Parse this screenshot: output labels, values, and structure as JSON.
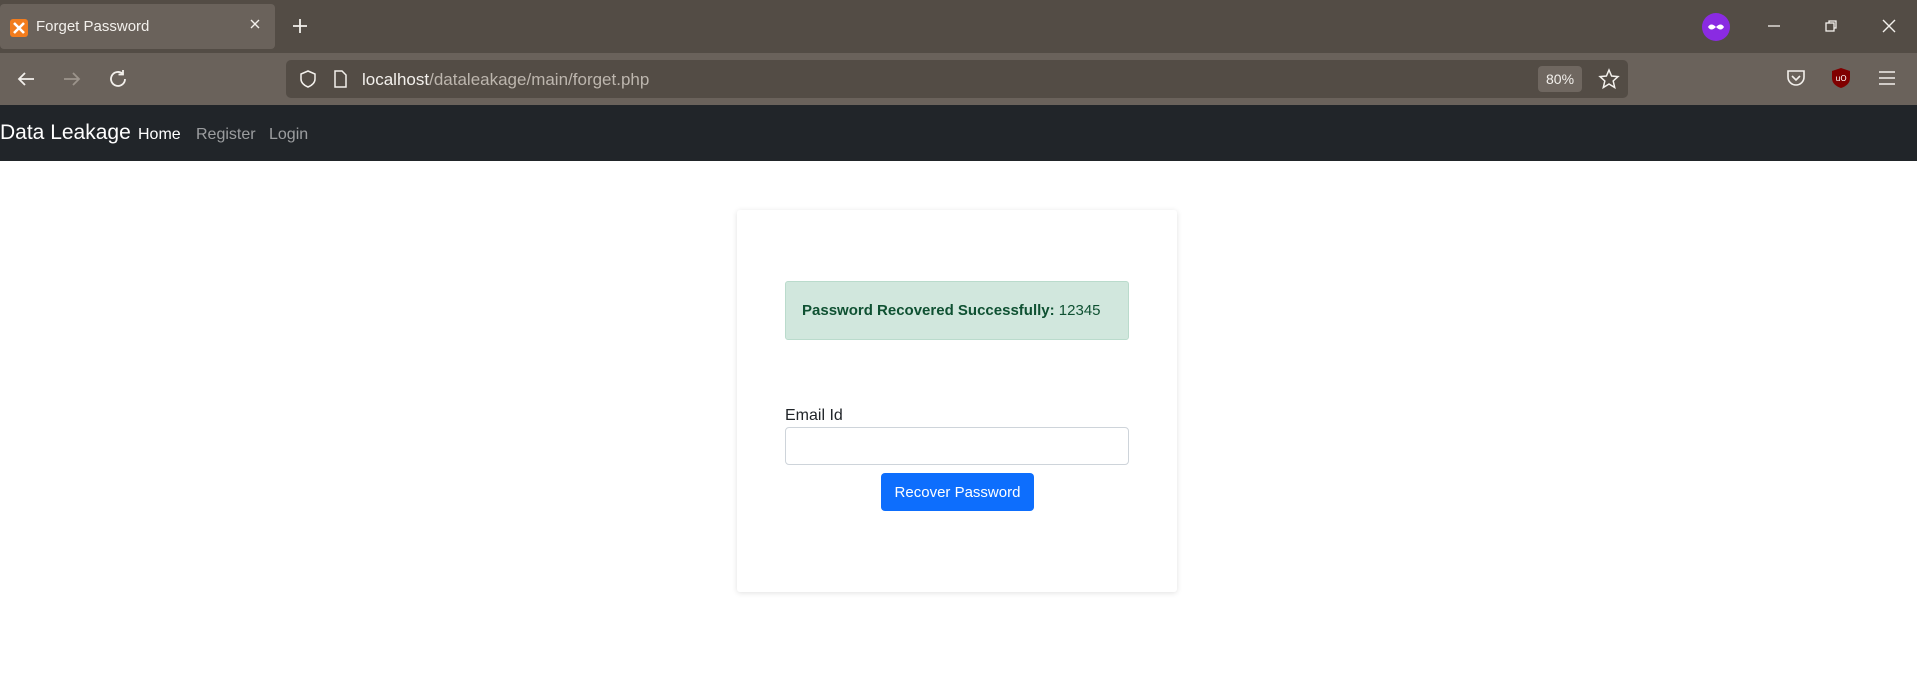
{
  "browser": {
    "tab_title": "Forget Password",
    "url_host": "localhost",
    "url_path": "/dataleakage/main/forget.php",
    "zoom": "80%"
  },
  "site": {
    "brand": "Data Leakage",
    "nav": [
      {
        "label": "Home",
        "active": true
      },
      {
        "label": "Register",
        "active": false
      },
      {
        "label": "Login",
        "active": false
      }
    ]
  },
  "alert": {
    "bold": "Password Recovered Successfully:",
    "value": "12345",
    "color": "#d1e7dd"
  },
  "form": {
    "email_label": "Email Id",
    "email_value": "",
    "submit_label": "Recover Password",
    "button_color": "#0d6efd"
  }
}
